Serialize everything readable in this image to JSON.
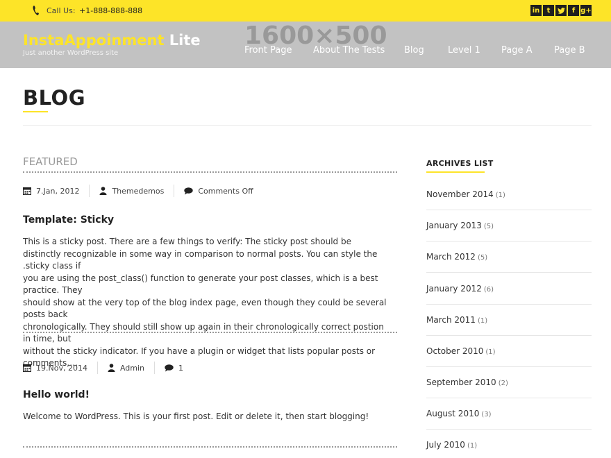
{
  "topbar": {
    "call_label": "Call Us:",
    "phone": "+1-888-888-888",
    "social": [
      "in",
      "t",
      "twitter",
      "f",
      "g+"
    ]
  },
  "header": {
    "placeholder": "1600×500",
    "site_title_a": "InstaAppoinment",
    "site_title_b": "Lite",
    "tagline": "Just another WordPress site",
    "nav": [
      "Front Page",
      "About The Tests",
      "Blog",
      "Level 1",
      "Page A",
      "Page B"
    ]
  },
  "page": {
    "title": "BLOG"
  },
  "posts": [
    {
      "label": "FEATURED",
      "date": "7.Jan, 2012",
      "author": "Themedemos",
      "comments": "Comments Off",
      "title": "Template: Sticky",
      "excerpt": [
        "This is a sticky post. There are a few things to verify: The sticky post should be",
        "distinctly recognizable in some way in comparison to normal posts. You can style the .sticky class if",
        "you are using the post_class() function to generate your post classes, which is a best practice. They",
        "should show at the very top of the blog index page, even though they could be several posts back",
        "chronologically. They should still show up again in their chronologically correct postion in time, but",
        "without the sticky indicator. If you have a plugin or widget that lists popular posts or comments,…"
      ]
    },
    {
      "date": "19.Nov, 2014",
      "author": "Admin",
      "comments": "1",
      "title": "Hello world!",
      "excerpt": [
        "Welcome to WordPress. This is your first post. Edit or delete it, then start blogging!"
      ]
    }
  ],
  "sidebar": {
    "heading": "ARCHIVES LIST",
    "archives": [
      {
        "month": "November 2014",
        "count": "(1)"
      },
      {
        "month": "January 2013",
        "count": "(5)"
      },
      {
        "month": "March 2012",
        "count": "(5)"
      },
      {
        "month": "January 2012",
        "count": "(6)"
      },
      {
        "month": "March 2011",
        "count": "(1)"
      },
      {
        "month": "October 2010",
        "count": "(1)"
      },
      {
        "month": "September 2010",
        "count": "(2)"
      },
      {
        "month": "August 2010",
        "count": "(3)"
      },
      {
        "month": "July 2010",
        "count": "(1)"
      }
    ]
  },
  "colors": {
    "accent": "#fde428",
    "header_bg": "#c2c2c2"
  }
}
